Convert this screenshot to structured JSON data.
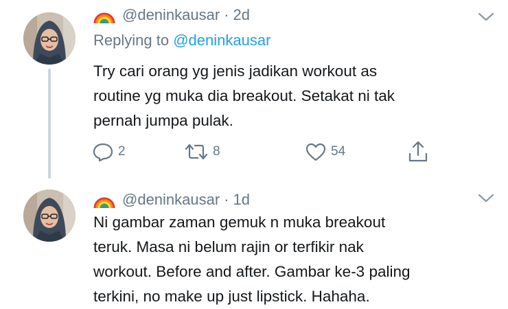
{
  "tweets": [
    {
      "handle": "@deninkausar",
      "dot": "·",
      "time": "2d",
      "replying_prefix": "Replying to",
      "replying_handle": "@deninkausar",
      "lines": [
        "Try cari orang yg jenis jadikan workout as",
        "routine yg muka dia breakout. Setakat ni tak",
        "pernah jumpa pulak."
      ],
      "replies": "2",
      "retweets": "8",
      "likes": "54"
    },
    {
      "handle": "@deninkausar",
      "dot": "·",
      "time": "1d",
      "lines": [
        "Ni gambar zaman gemuk n muka breakout",
        "teruk. Masa ni belum rajin or terfikir nak",
        "workout. Before and after. Gambar ke-3 paling",
        "terkini, no make up just lipstick. Hahaha."
      ]
    }
  ],
  "icons": {
    "name_emoji": "rainbow-icon",
    "menu": "chevron-down-icon",
    "reply": "reply-icon",
    "retweet": "retweet-icon",
    "like": "heart-icon",
    "share": "share-icon"
  },
  "colors": {
    "text": "#14171a",
    "secondary": "#657786",
    "link": "#1da1f2",
    "thread_line": "#ccd6dd"
  }
}
